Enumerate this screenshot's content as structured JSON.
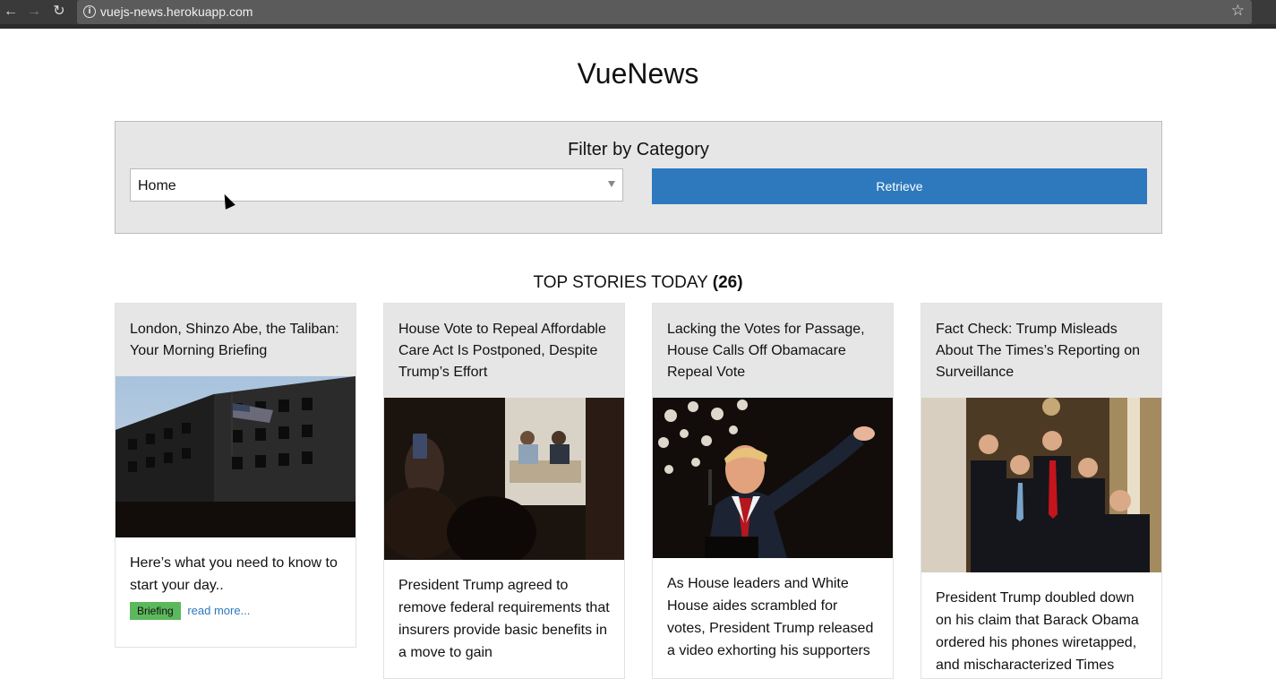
{
  "browser": {
    "url": "vuejs-news.herokuapp.com",
    "back_glyph": "←",
    "forward_glyph": "→",
    "reload_glyph": "↻",
    "info_glyph": "i",
    "star_glyph": "☆"
  },
  "page": {
    "title": "VueNews"
  },
  "filter": {
    "title": "Filter by Category",
    "selected": "Home",
    "button": "Retrieve"
  },
  "stories": {
    "heading": "TOP STORIES TODAY",
    "count": "(26)",
    "items": [
      {
        "title": "London, Shinzo Abe, the Taliban: Your Morning Briefing",
        "abstract": "Here’s what you need to know to start your day..",
        "tag": "Briefing",
        "link": "read more..."
      },
      {
        "title": "House Vote to Repeal Affordable Care Act Is Postponed, Despite Trump’s Effort",
        "abstract": "President Trump agreed to remove federal requirements that insurers provide basic benefits in a move to gain"
      },
      {
        "title": "Lacking the Votes for Passage, House Calls Off Obamacare Repeal Vote",
        "abstract": "As House leaders and White House aides scrambled for votes, President Trump released a video exhorting his supporters"
      },
      {
        "title": "Fact Check: Trump Misleads About The Times’s Reporting on Surveillance",
        "abstract": "President Trump doubled down on his claim that Barack Obama ordered his phones wiretapped, and mischaracterized Times"
      }
    ]
  },
  "colors": {
    "accent": "#2e79bd",
    "badge": "#5cb85c",
    "panel": "#e6e6e6"
  }
}
